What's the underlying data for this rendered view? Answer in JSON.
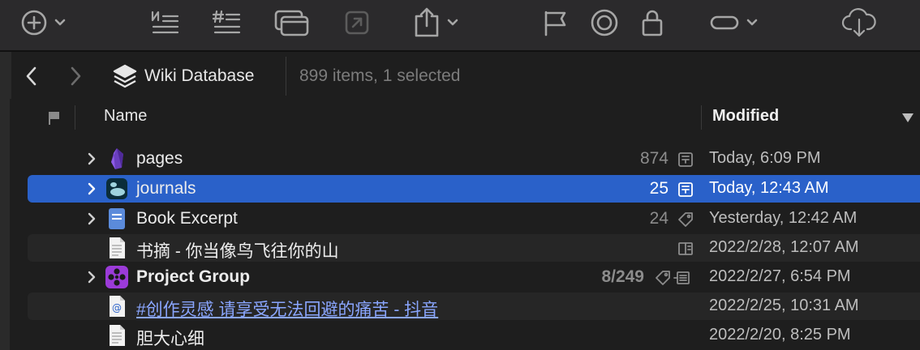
{
  "toolbar": {
    "items": [
      {
        "name": "add",
        "icon": "plus-circle-icon",
        "has_menu": true
      },
      {
        "name": "numbered-list",
        "icon": "numbered-list-icon"
      },
      {
        "name": "hashtag-list",
        "icon": "hashtag-list-icon"
      },
      {
        "name": "windows",
        "icon": "stacked-windows-icon"
      },
      {
        "name": "open-external",
        "icon": "open-external-icon"
      },
      {
        "name": "share",
        "icon": "share-icon",
        "has_menu": true
      },
      {
        "name": "flag",
        "icon": "flag-icon"
      },
      {
        "name": "target",
        "icon": "target-icon"
      },
      {
        "name": "lock",
        "icon": "lock-icon"
      },
      {
        "name": "tag-shape",
        "icon": "capsule-icon",
        "has_menu": true
      },
      {
        "name": "cloud-sync",
        "icon": "cloud-sync-icon"
      }
    ]
  },
  "pathbar": {
    "title": "Wiki Database",
    "status": "899 items, 1 selected"
  },
  "columns": {
    "name": "Name",
    "modified": "Modified"
  },
  "rows": [
    {
      "name": "pages",
      "count": "874",
      "kind_icon": "document-stack-icon",
      "date": "Today, 6:09 PM",
      "expandable": true,
      "icon": "obsidian-gem-icon",
      "style": "normal"
    },
    {
      "name": "journals",
      "count": "25",
      "kind_icon": "document-stack-icon",
      "date": "Today, 12:43 AM",
      "expandable": true,
      "icon": "logseq-icon",
      "style": "normal",
      "selected": true
    },
    {
      "name": "Book Excerpt",
      "count": "24",
      "kind_icon": "tag-icon",
      "date": "Yesterday, 12:42 AM",
      "expandable": true,
      "icon": "blue-document-icon",
      "style": "normal"
    },
    {
      "name": "书摘 - 你当像鸟飞往你的山",
      "count": "",
      "kind_icon": "split-view-icon",
      "date": "2022/2/28, 12:07 AM",
      "expandable": false,
      "icon": "text-document-icon",
      "style": "normal"
    },
    {
      "name": "Project Group",
      "count": "8/249",
      "kind_icon": "tag-list-icon",
      "date": "2022/2/27, 6:54 PM",
      "expandable": true,
      "icon": "purple-group-icon",
      "style": "bold"
    },
    {
      "name": "#创作灵感 请享受无法回避的痛苦 - 抖音",
      "count": "",
      "kind_icon": "",
      "date": "2022/2/25, 10:31 AM",
      "expandable": false,
      "icon": "web-link-document-icon",
      "style": "link"
    },
    {
      "name": "胆大心细",
      "count": "",
      "kind_icon": "",
      "date": "2022/2/20, 8:25 PM",
      "expandable": false,
      "icon": "text-document-icon",
      "style": "normal"
    }
  ],
  "colors": {
    "selection": "#2a61c9",
    "link": "#8aa6ff",
    "group_icon": "#9b3bd8",
    "document_icon": "#5b8bdb"
  }
}
